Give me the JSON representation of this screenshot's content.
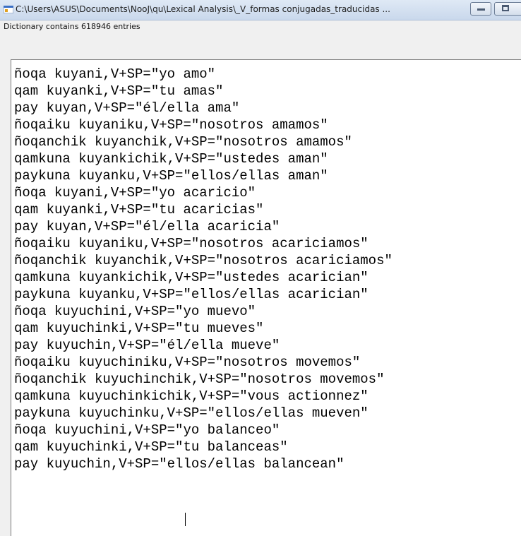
{
  "window": {
    "title": "C:\\Users\\ASUS\\Documents\\NooJ\\qu\\Lexical Analysis\\_V_formas conjugadas_traducidas ...",
    "icon": "app-window-icon",
    "controls": [
      "minimize-icon",
      "maximize-icon"
    ]
  },
  "info": {
    "entries_text": "Dictionary contains 618946 entries"
  },
  "editor": {
    "lines": [
      "ñoqa kuyani,V+SP=\"yo amo\"",
      "qam kuyanki,V+SP=\"tu amas\"",
      "pay kuyan,V+SP=\"él/ella ama\"",
      "ñoqaiku kuyaniku,V+SP=\"nosotros amamos\"",
      "ñoqanchik kuyanchik,V+SP=\"nosotros amamos\"",
      "qamkuna kuyankichik,V+SP=\"ustedes aman\"",
      "paykuna kuyanku,V+SP=\"ellos/ellas aman\"",
      "ñoqa kuyani,V+SP=\"yo acaricio\"",
      "qam kuyanki,V+SP=\"tu acaricias\"",
      "pay kuyan,V+SP=\"él/ella acaricia\"",
      "ñoqaiku kuyaniku,V+SP=\"nosotros acariciamos\"",
      "ñoqanchik kuyanchik,V+SP=\"nosotros acariciamos\"",
      "qamkuna kuyankichik,V+SP=\"ustedes acarician\"",
      "paykuna kuyanku,V+SP=\"ellos/ellas acarician\"",
      "ñoqa kuyuchini,V+SP=\"yo muevo\"",
      "qam kuyuchinki,V+SP=\"tu mueves\"",
      "pay kuyuchin,V+SP=\"él/ella mueve\"",
      "ñoqaiku kuyuchiniku,V+SP=\"nosotros movemos\"",
      "ñoqanchik kuyuchinchik,V+SP=\"nosotros movemos\"",
      "qamkuna kuyuchinkichik,V+SP=\"vous actionnez\"",
      "paykuna kuyuchinku,V+SP=\"ellos/ellas mueven\"",
      "ñoqa kuyuchini,V+SP=\"yo balanceo\"",
      "qam kuyuchinki,V+SP=\"tu balanceas\"",
      "pay kuyuchin,V+SP=\"ellos/ellas balancean\""
    ]
  },
  "colors": {
    "titlebar": "#c9d8ec",
    "window_bg": "#f0f0f0",
    "editor_bg": "#ffffff"
  }
}
